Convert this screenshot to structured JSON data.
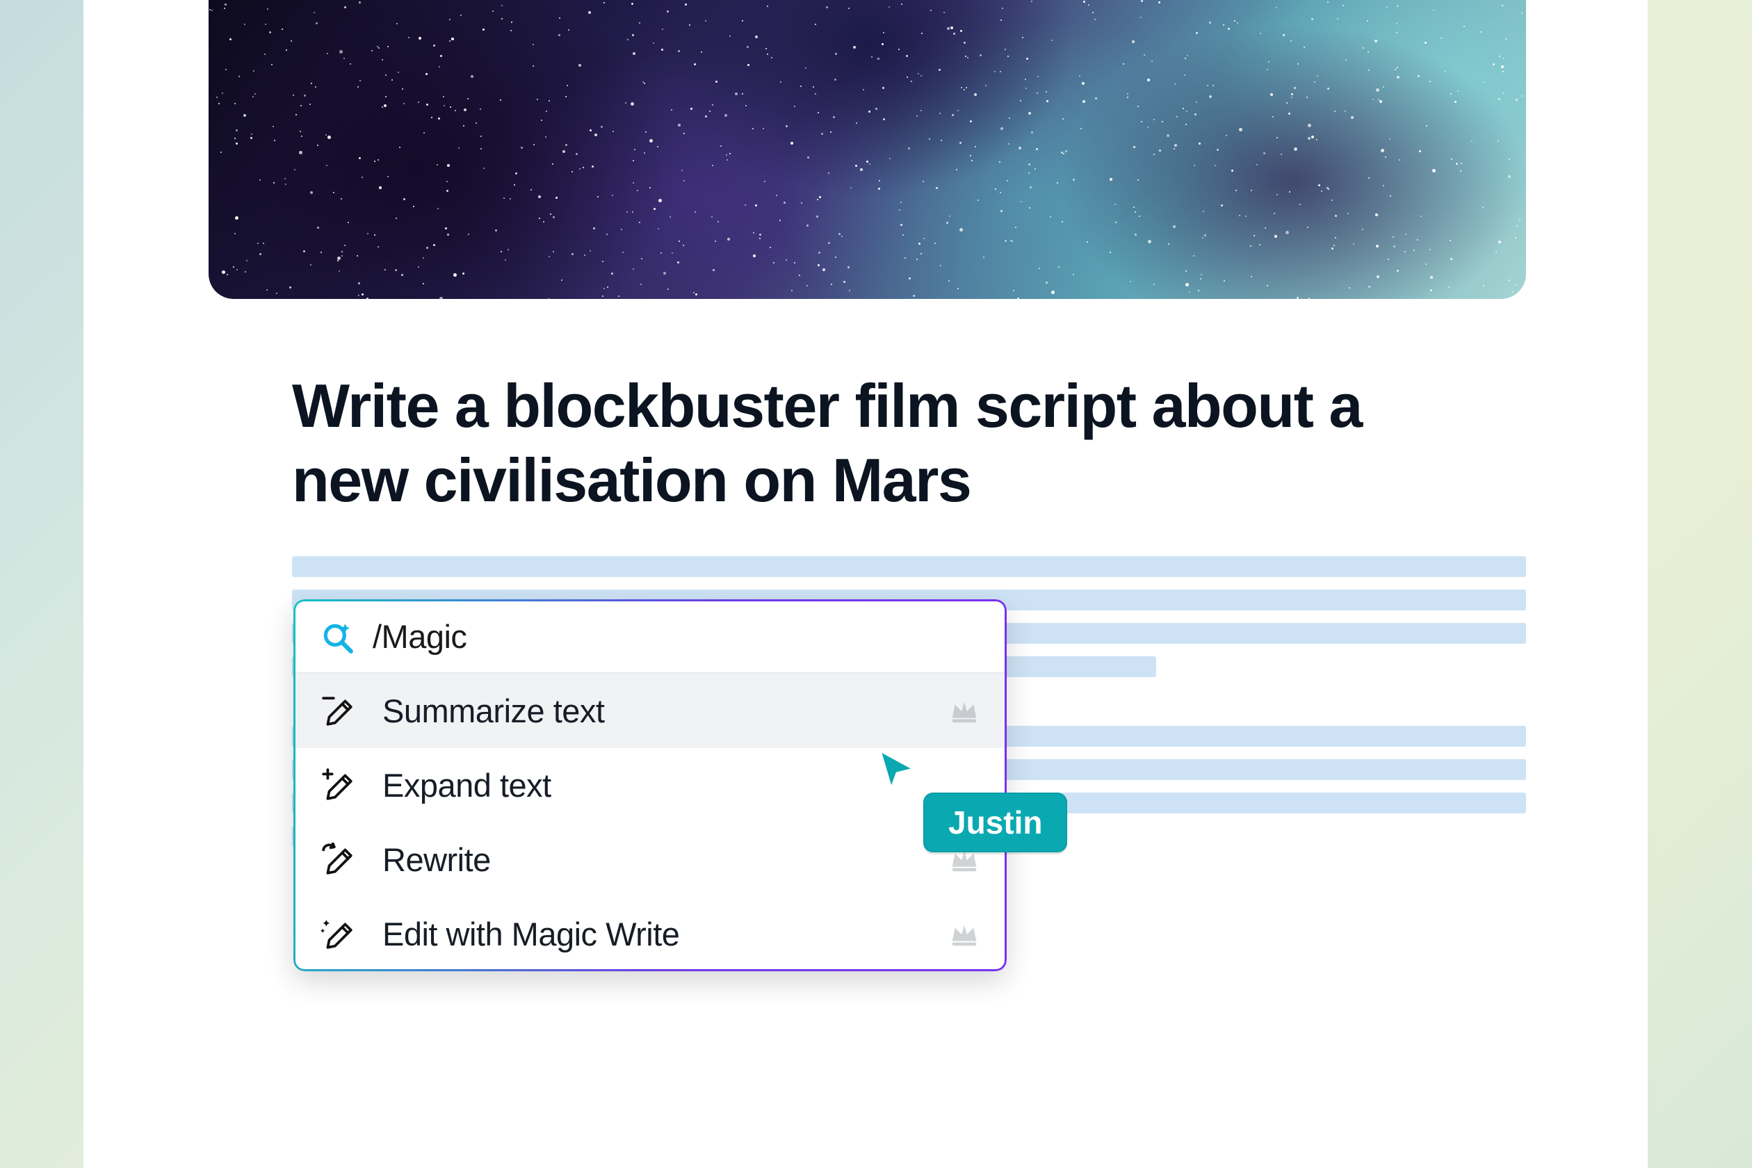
{
  "document": {
    "title": "Write a blockbuster film script about a new civilisation on Mars"
  },
  "magic_menu": {
    "search_value": "/Magic",
    "items": [
      {
        "label": "Summarize text",
        "icon": "pencil-minus",
        "premium": true,
        "highlight": true
      },
      {
        "label": "Expand text",
        "icon": "pencil-plus",
        "premium": false,
        "highlight": false
      },
      {
        "label": "Rewrite",
        "icon": "pencil-swirl",
        "premium": true,
        "highlight": false
      },
      {
        "label": "Edit with Magic Write",
        "icon": "pencil-sparkle",
        "premium": true,
        "highlight": false
      }
    ]
  },
  "collaborator": {
    "name": "Justin",
    "color": "#0aa9b1"
  }
}
